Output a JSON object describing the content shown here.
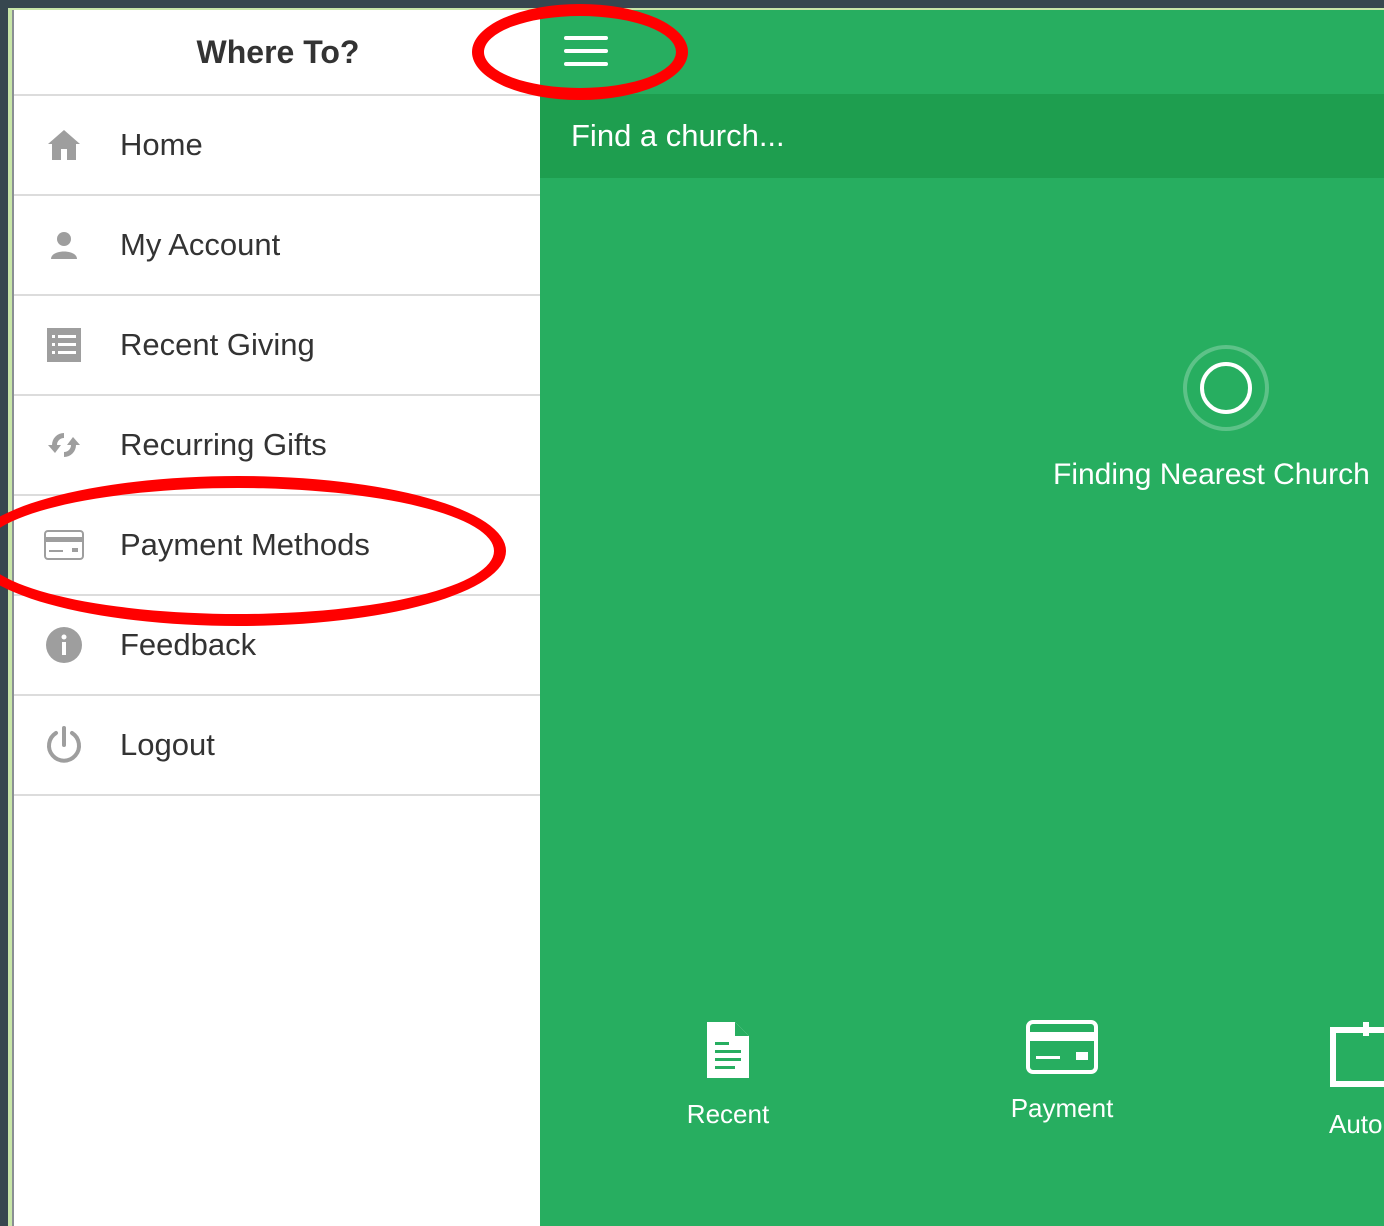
{
  "drawer": {
    "title": "Where To?",
    "items": [
      {
        "label": "Home",
        "icon": "home-icon"
      },
      {
        "label": "My Account",
        "icon": "user-icon"
      },
      {
        "label": "Recent Giving",
        "icon": "list-icon"
      },
      {
        "label": "Recurring Gifts",
        "icon": "refresh-icon"
      },
      {
        "label": "Payment Methods",
        "icon": "credit-card-icon"
      },
      {
        "label": "Feedback",
        "icon": "info-icon"
      },
      {
        "label": "Logout",
        "icon": "power-icon"
      }
    ]
  },
  "main": {
    "search_placeholder": "Find a church...",
    "status": "Finding Nearest Church",
    "bottom_nav": [
      {
        "label": "Recent",
        "icon": "document-icon"
      },
      {
        "label": "Payment",
        "icon": "credit-card-icon"
      },
      {
        "label": "Auto",
        "icon": "calendar-icon"
      }
    ]
  },
  "colors": {
    "brand_green": "#27ae60",
    "search_green": "#1e9e4f",
    "annotation_red": "#ff0000"
  }
}
